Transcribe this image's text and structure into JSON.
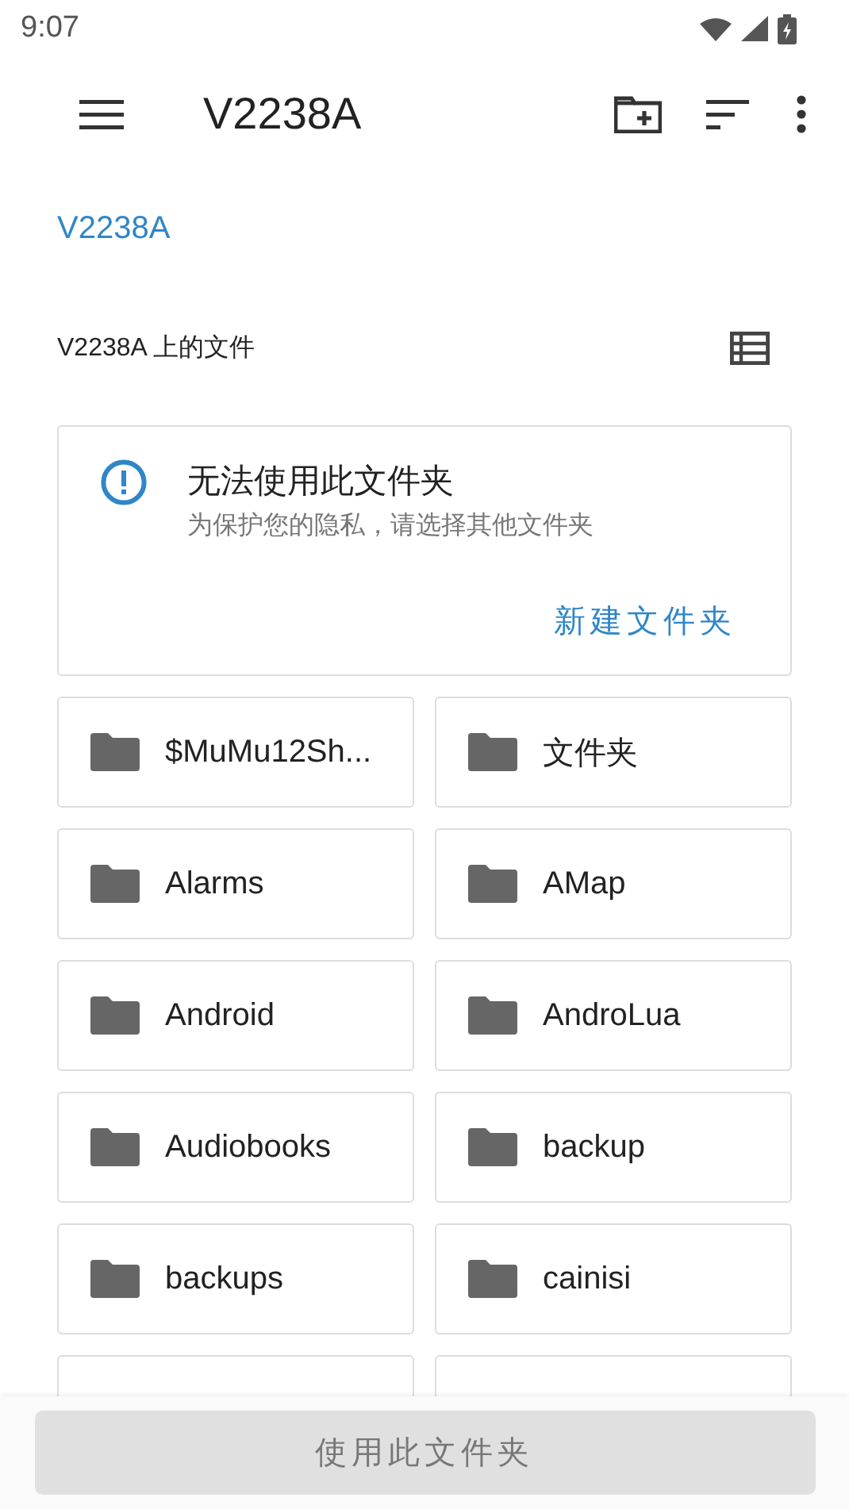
{
  "status_bar": {
    "time": "9:07"
  },
  "toolbar": {
    "title": "V2238A"
  },
  "breadcrumb": [
    {
      "label": "V2238A",
      "selected": true
    }
  ],
  "section": {
    "title": "V2238A 上的文件"
  },
  "notice": {
    "title": "无法使用此文件夹",
    "message": "为保护您的隐私，请选择其他文件夹",
    "action": "新建文件夹"
  },
  "folders": [
    {
      "name": "$MuMu12Sh..."
    },
    {
      "name": "文件夹"
    },
    {
      "name": "Alarms"
    },
    {
      "name": "AMap"
    },
    {
      "name": "Android"
    },
    {
      "name": "AndroLua"
    },
    {
      "name": "Audiobooks"
    },
    {
      "name": "backup"
    },
    {
      "name": "backups"
    },
    {
      "name": "cainisi"
    }
  ],
  "bottom_button": {
    "label": "使用此文件夹",
    "disabled": true
  }
}
